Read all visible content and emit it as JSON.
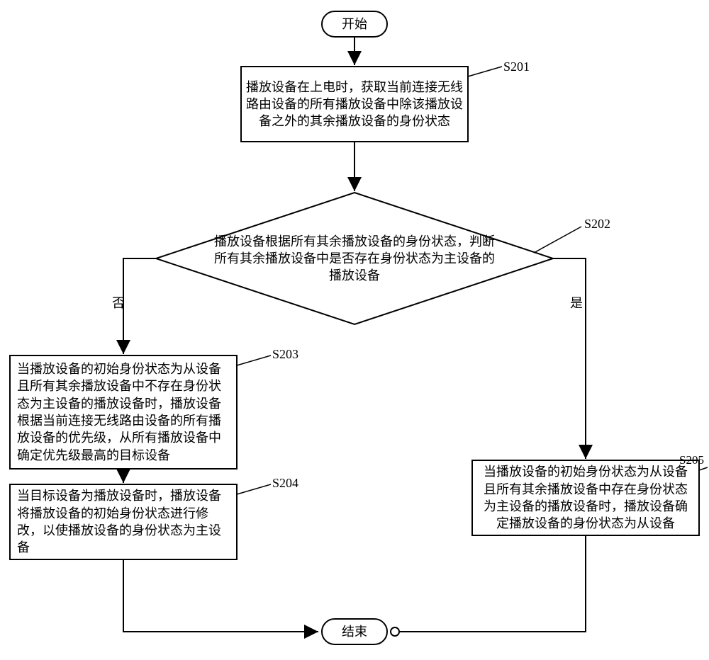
{
  "chart_data": {
    "type": "flowchart",
    "nodes": [
      {
        "id": "start",
        "type": "terminator",
        "text": "开始"
      },
      {
        "id": "s201",
        "type": "process",
        "text": "播放设备在上电时，获取当前连接无线路由设备的所有播放设备中除该播放设备之外的其余播放设备的身份状态",
        "tag": "S201"
      },
      {
        "id": "s202",
        "type": "decision",
        "text": "播放设备根据所有其余播放设备的身份状态，判断所有其余播放设备中是否存在身份状态为主设备的播放设备",
        "tag": "S202"
      },
      {
        "id": "s203",
        "type": "process",
        "text": "当播放设备的初始身份状态为从设备且所有其余播放设备中不存在身份状态为主设备的播放设备时，播放设备根据当前连接无线路由设备的所有播放设备的优先级，从所有播放设备中确定优先级最高的目标设备",
        "tag": "S203"
      },
      {
        "id": "s204",
        "type": "process",
        "text": "当目标设备为播放设备时，播放设备将播放设备的初始身份状态进行修改，以使播放设备的身份状态为主设备",
        "tag": "S204"
      },
      {
        "id": "s205",
        "type": "process",
        "text": "当播放设备的初始身份状态为从设备且所有其余播放设备中存在身份状态为主设备的播放设备时，播放设备确定播放设备的身份状态为从设备",
        "tag": "S205"
      },
      {
        "id": "end",
        "type": "terminator",
        "text": "结束"
      }
    ],
    "edges": [
      {
        "from": "start",
        "to": "s201"
      },
      {
        "from": "s201",
        "to": "s202"
      },
      {
        "from": "s202",
        "to": "s203",
        "label": "否"
      },
      {
        "from": "s202",
        "to": "s205",
        "label": "是"
      },
      {
        "from": "s203",
        "to": "s204"
      },
      {
        "from": "s204",
        "to": "end"
      },
      {
        "from": "s205",
        "to": "end"
      }
    ]
  },
  "labels": {
    "start": "开始",
    "end": "结束",
    "no": "否",
    "yes": "是",
    "s201_tag": "S201",
    "s202_tag": "S202",
    "s203_tag": "S203",
    "s204_tag": "S204",
    "s205_tag": "S205",
    "s201_text": "播放设备在上电时，获取当前连接无线路由设备的所有播放设备中除该播放设备之外的其余播放设备的身份状态",
    "s202_text": "播放设备根据所有其余播放设备的身份状态，判断所有其余播放设备中是否存在身份状态为主设备的播放设备",
    "s203_text": "当播放设备的初始身份状态为从设备且所有其余播放设备中不存在身份状态为主设备的播放设备时，播放设备根据当前连接无线路由设备的所有播放设备的优先级，从所有播放设备中确定优先级最高的目标设备",
    "s204_text": "当目标设备为播放设备时，播放设备将播放设备的初始身份状态进行修改，以使播放设备的身份状态为主设备",
    "s205_text": "当播放设备的初始身份状态为从设备且所有其余播放设备中存在身份状态为主设备的播放设备时，播放设备确定播放设备的身份状态为从设备"
  }
}
